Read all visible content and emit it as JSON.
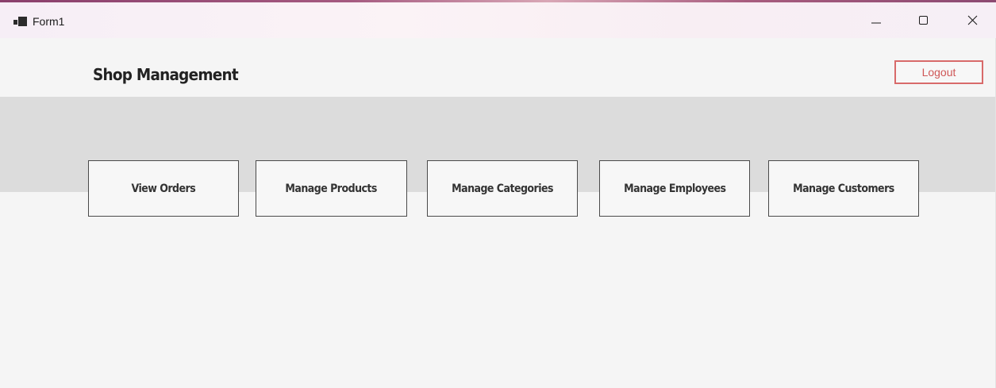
{
  "window": {
    "title": "Form1",
    "controls": {
      "minimize_icon": "minimize-icon",
      "maximize_icon": "maximize-icon",
      "close_icon": "close-icon"
    }
  },
  "header": {
    "title": "Shop Management",
    "logout_label": "Logout"
  },
  "nav": {
    "buttons": [
      {
        "label": "View Orders"
      },
      {
        "label": "Manage Products"
      },
      {
        "label": "Manage Categories"
      },
      {
        "label": "Manage Employees"
      },
      {
        "label": "Manage Customers"
      }
    ]
  },
  "colors": {
    "background": "#f5f5f5",
    "band": "#dcdcdc",
    "logout_border": "#d86a6a",
    "logout_text": "#cf5757",
    "button_border": "#4a4a4a"
  }
}
